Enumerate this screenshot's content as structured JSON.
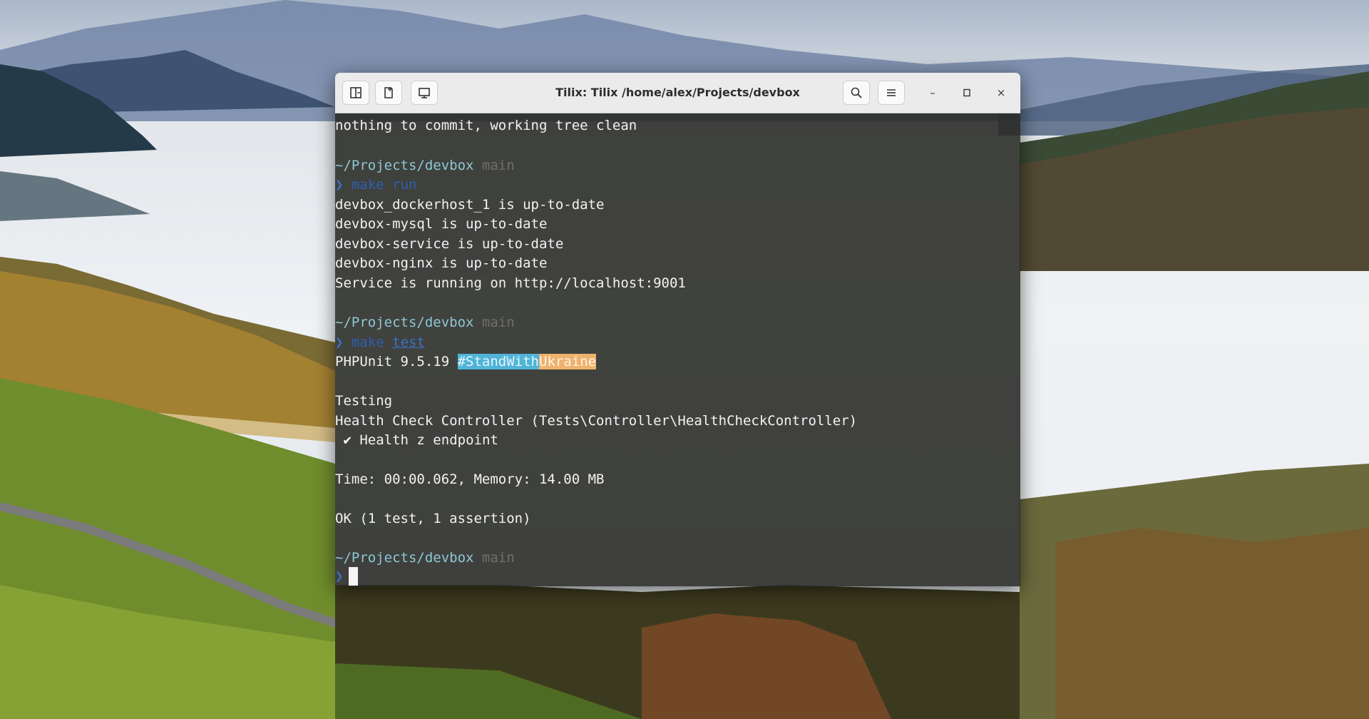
{
  "window": {
    "title": "Tilix: Tilix /home/alex/Projects/devbox",
    "buttons": {
      "add_terminal_right": "add-terminal-right-icon",
      "add_terminal_down": "add-terminal-down-icon",
      "sidebar": "session-sidebar-icon",
      "search": "search-icon",
      "menu": "hamburger-menu-icon",
      "minimize": "–",
      "maximize": "▫",
      "close": "×"
    }
  },
  "terminal": {
    "lines": {
      "l1": "nothing to commit, working tree clean",
      "p1_path": "~/Projects/devbox",
      "p1_branch": "main",
      "prompt_arrow": "❯",
      "cmd1_make": "make",
      "cmd1_target": "run",
      "o1": "devbox_dockerhost_1 is up-to-date",
      "o2": "devbox-mysql is up-to-date",
      "o3": "devbox-service is up-to-date",
      "o4": "devbox-nginx is up-to-date",
      "o5": "Service is running on http://localhost:9001",
      "p2_path": "~/Projects/devbox",
      "p2_branch": "main",
      "cmd2_make": "make",
      "cmd2_target": "test",
      "phpunit": "PHPUnit 9.5.19",
      "tag_part1": "#StandWith",
      "tag_part2": "Ukraine",
      "testing": "Testing",
      "suite": "Health Check Controller (Tests\\Controller\\HealthCheckController)",
      "check_mark": "✔",
      "test_name": "Health z endpoint",
      "time": "Time: 00:00.062, Memory: 14.00 MB",
      "ok": "OK (1 test, 1 assertion)",
      "p3_path": "~/Projects/devbox",
      "p3_branch": "main"
    }
  },
  "colors": {
    "terminal_bg": "#282924",
    "path": "#8ec7d6",
    "branch": "#6f6f6f",
    "prompt": "#3b72c8",
    "ukraine_blue": "#4fb4d8",
    "ukraine_yellow": "#efb26d"
  }
}
